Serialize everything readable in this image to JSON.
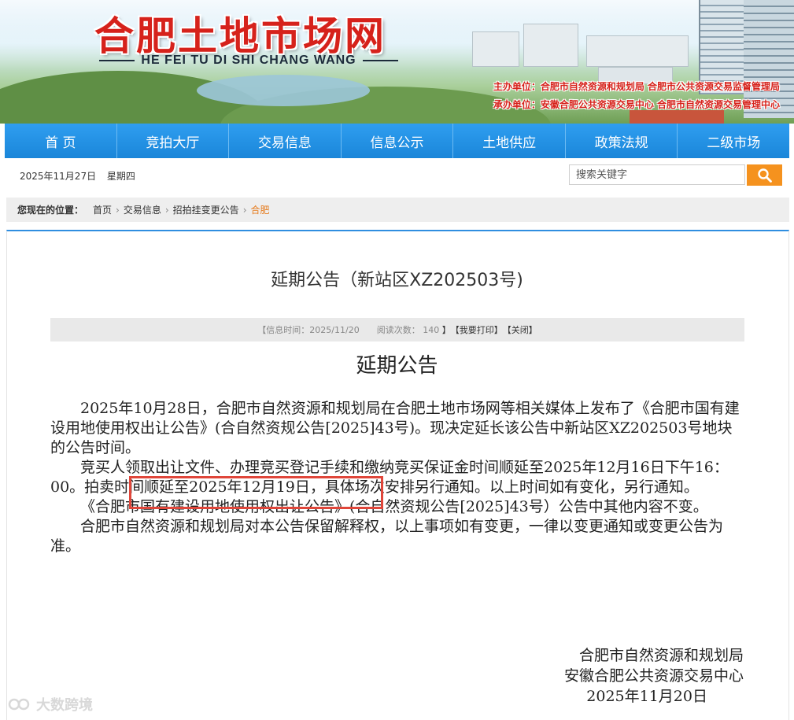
{
  "header": {
    "site_title": "合肥土地市场网",
    "site_pinyin": "HE FEI TU DI SHI CHANG WANG",
    "sponsor_line": "主办单位：合肥市自然资源和规划局  合肥市公共资源交易监督管理局",
    "organizer_line": "承办单位：安徽合肥公共资源交易中心  合肥市自然资源交易管理中心"
  },
  "nav": {
    "items": [
      "首 页",
      "竞拍大厅",
      "交易信息",
      "信息公示",
      "土地供应",
      "政策法规",
      "二级市场"
    ]
  },
  "datebar": {
    "date": "2025年11月27日",
    "weekday": "星期四"
  },
  "search": {
    "placeholder": "搜索关键字",
    "icon": "search-icon"
  },
  "breadcrumb": {
    "label": "您现在的位置：",
    "items": [
      "首页",
      "交易信息",
      "招拍挂变更公告",
      "合肥"
    ]
  },
  "article": {
    "title": "延期公告（新站区XZ202503号)",
    "info": {
      "date_label": "【信息时间：",
      "date_value": "2025/11/20",
      "views_label": "阅读次数：",
      "views_value": "140",
      "close_bracket": "】",
      "print": "【我要打印】",
      "close": "【关闭】"
    },
    "heading": "延期公告",
    "paragraphs": [
      "2025年10月28日，合肥市自然资源和规划局在合肥土地市场网等相关媒体上发布了《合肥市国有建设用地使用权出让公告》(合自然资规公告[2025]43号)。现决定延长该公告中新站区XZ202503号地块的公告时间。",
      "竞买人领取出让文件、办理竞买登记手续和缴纳竞买保证金时间顺延至2025年12月16日下午16：00。拍卖时间顺延至2025年12月19日，具体场次安排另行通知。以上时间如有变化，另行通知。",
      "《合肥市国有建设用地使用权出让公告》(合自然资规公告[2025]43号）公告中其他内容不变。",
      "合肥市自然资源和规划局对本公告保留解释权，以上事项如有变更，一律以变更通知或变更公告为准。"
    ],
    "signature": {
      "org1": "合肥市自然资源和规划局",
      "org2": "安徽合肥公共资源交易中心",
      "date": "2025年11月20日"
    }
  },
  "watermark": {
    "text": "大数跨境"
  },
  "colors": {
    "brand_red": "#d6221b",
    "nav_blue": "#1a86d9",
    "search_orange": "#f5921e",
    "highlight_red": "#e0463a"
  }
}
